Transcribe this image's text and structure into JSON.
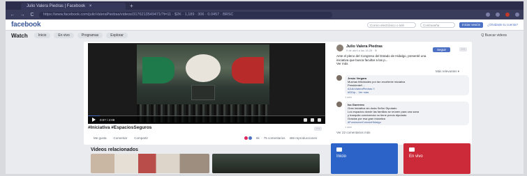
{
  "browser": {
    "tab_title": "Julio Valera Piedras | Facebook",
    "tab_close": "×",
    "new_tab": "+",
    "url": "https://www.facebook.com/julioValeraPiedras/videos/3176213549471/?t=11 · $2K · 1,189 · 306 · 0.0457 · BRSC",
    "back": "←",
    "forward": "→",
    "reload": "C"
  },
  "fb": {
    "logo": "facebook",
    "search_placeholder": "Correo electrónico o telé",
    "password_placeholder": "Contraseña",
    "join_label": "Iniciar sesión",
    "forgot_label": "¿Olvidaste tu cuenta?"
  },
  "watch": {
    "title": "Watch",
    "tabs": [
      "Inicio",
      "En vivo",
      "Programas",
      "Explorar"
    ],
    "search_label": "Q Buscar videos"
  },
  "video": {
    "time": "0:07 / 2:09",
    "progress": 0.05,
    "hashtags": "#Iniciativa #EspaciosSeguros",
    "actions": [
      "Me gusta",
      "Comentar",
      "Compartir"
    ],
    "reactions_count": "6k",
    "comments_count": "75 comentarios",
    "views": "466 reproducciones"
  },
  "post": {
    "author": "Julio Valera Piedras",
    "date": "9 de abril a las 18:28 · ⊕",
    "follow_label": "Seguir",
    "more_label": "···",
    "text_lines": [
      "Ante el pleno del Congreso del Estado de Hidalgo, presenté una",
      "iniciativa que busca facultar a las p...",
      "Ver más"
    ],
    "relevant_label": "Más relevantes ▾",
    "see_more_comments": "Ver 22 comentarios más",
    "ellipsis": "···"
  },
  "comments": [
    {
      "name": "Jesús Vergara",
      "lines": [
        "Muchas felicidades por tan excelente iniciativa",
        "Presidente!!...",
        "#JulioValeraPiedras !!",
        "#DDip... Ver más"
      ],
      "meta": "1 sem"
    },
    {
      "name": "Iss Guerrero",
      "lines": [
        "Gran iniciativa sin duda Señor Diputado",
        "Los espacios donde las familias se reúnen para una sana",
        "y tranquila convivencia no tiene precio diputado.",
        "Gracias por esa gran iniciativa",
        "#FundacionColosioHidalgo"
      ],
      "meta": "1 sem"
    }
  ],
  "related": {
    "title": "Videos relacionados"
  },
  "side_panels": [
    {
      "label": "Inicio",
      "color": "#2b63c9"
    },
    {
      "label": "En vivo",
      "color": "#cc2a39"
    }
  ]
}
